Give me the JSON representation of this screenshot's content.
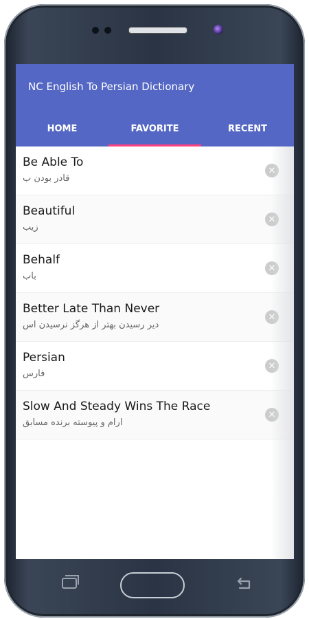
{
  "app": {
    "title": "NC English To Persian Dictionary"
  },
  "tabs": [
    {
      "label": "HOME",
      "active": false
    },
    {
      "label": "FAVORITE",
      "active": true
    },
    {
      "label": "RECENT",
      "active": false
    }
  ],
  "favorites": [
    {
      "word": "Be Able To",
      "meaning": "قادر بودن ب"
    },
    {
      "word": "Beautiful",
      "meaning": "زیب"
    },
    {
      "word": "Behalf",
      "meaning": "باب"
    },
    {
      "word": "Better Late Than Never",
      "meaning": "دیر رسیدن بهتر از هرگز نرسیدن اس"
    },
    {
      "word": "Persian",
      "meaning": "فارس"
    },
    {
      "word": "Slow And Steady Wins The Race",
      "meaning": "ارام و پیوسته برنده مسابق"
    }
  ],
  "icons": {
    "remove": "remove-circle-icon",
    "back": "back-arrow-icon",
    "recent": "recent-apps-icon"
  },
  "colors": {
    "appbar": "#5467c4",
    "tab_indicator": "#ff4081"
  }
}
